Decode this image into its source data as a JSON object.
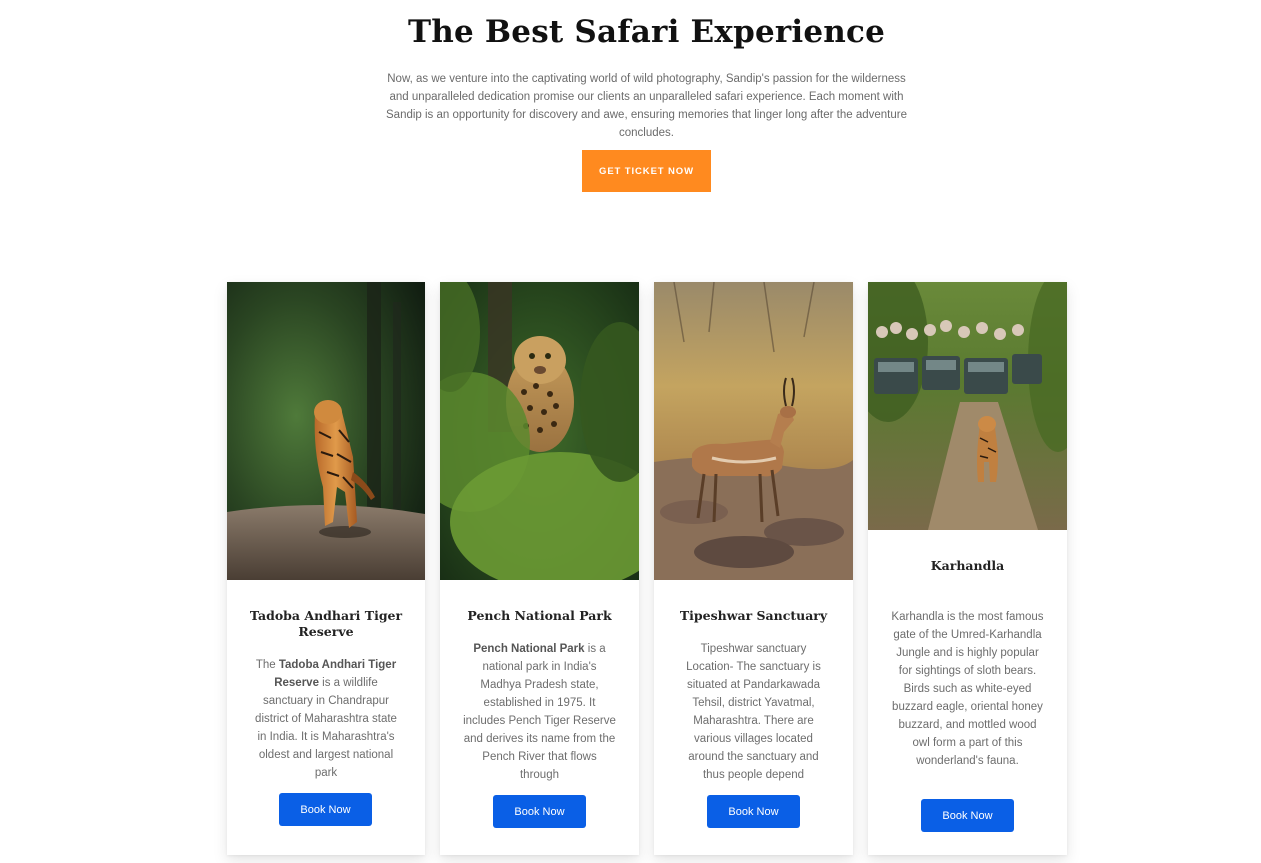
{
  "hero": {
    "title": "The Best Safari Experience",
    "description": "Now, as we venture into the captivating world of wild photography, Sandip's passion for the wilderness and unparalleled dedication promise our clients an unparalleled safari experience. Each moment with Sandip is an opportunity for discovery and awe, ensuring memories that linger long after the adventure concludes.",
    "cta_label": "GET TICKET NOW"
  },
  "colors": {
    "accent_orange": "#ff8a1f",
    "button_blue": "#0a5fe6"
  },
  "cards": [
    {
      "image": "tiger-walking-photo",
      "title": "Tadoba Andhari Tiger Reserve",
      "desc_prefix": "The ",
      "desc_bold": "Tadoba Andhari Tiger Reserve",
      "desc_rest": " is a wildlife sanctuary in Chandrapur district of Maharashtra state in India. It is Maharashtra's oldest and largest national park",
      "button_label": "Book Now"
    },
    {
      "image": "leopard-in-foliage-photo",
      "title": "Pench National Park",
      "desc_prefix": "",
      "desc_bold": "Pench National Park",
      "desc_rest": " is a national park in India's Madhya Pradesh state, established in 1975. It includes Pench Tiger Reserve and derives its name from the Pench River that flows through",
      "button_label": "Book Now"
    },
    {
      "image": "blackbuck-antelope-photo",
      "title": "Tipeshwar Sanctuary",
      "desc_prefix": "",
      "desc_bold": "",
      "desc_rest": "Tipeshwar sanctuary Location- The sanctuary is situated at Pandarkawada Tehsil, district Yavatmal, Maharashtra. There are various villages located around the sanctuary and thus people depend",
      "button_label": "Book Now"
    },
    {
      "image": "tiger-with-safari-jeeps-photo",
      "title": "Karhandla",
      "desc_prefix": "",
      "desc_bold": "",
      "desc_rest": "Karhandla is the most famous gate of the Umred-Karhandla Jungle and is highly popular for sightings of sloth bears. Birds such as white-eyed buzzard eagle, oriental honey buzzard, and mottled wood owl form a part of this wonderland's fauna.",
      "button_label": "Book Now"
    }
  ]
}
